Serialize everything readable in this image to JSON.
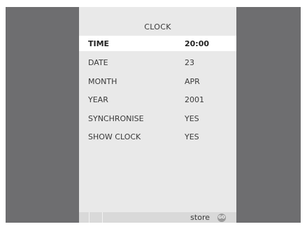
{
  "menu": {
    "title": "CLOCK",
    "items": [
      {
        "label": "TIME",
        "value": "20:00",
        "selected": true
      },
      {
        "label": "DATE",
        "value": "23"
      },
      {
        "label": "MONTH",
        "value": "APR"
      },
      {
        "label": "YEAR",
        "value": "2001"
      },
      {
        "label": "SYNCHRONISE",
        "value": "YES"
      },
      {
        "label": "SHOW CLOCK",
        "value": "YES"
      }
    ]
  },
  "footer": {
    "store_label": "store",
    "go_button": "GO",
    "go_icon": "go-button-icon"
  },
  "colors": {
    "background": "#6e6e70",
    "panel": "#e9e9e9",
    "selected_row": "#ffffff",
    "text": "#3a3a3a",
    "footer_bar": "#d9d9d9"
  }
}
